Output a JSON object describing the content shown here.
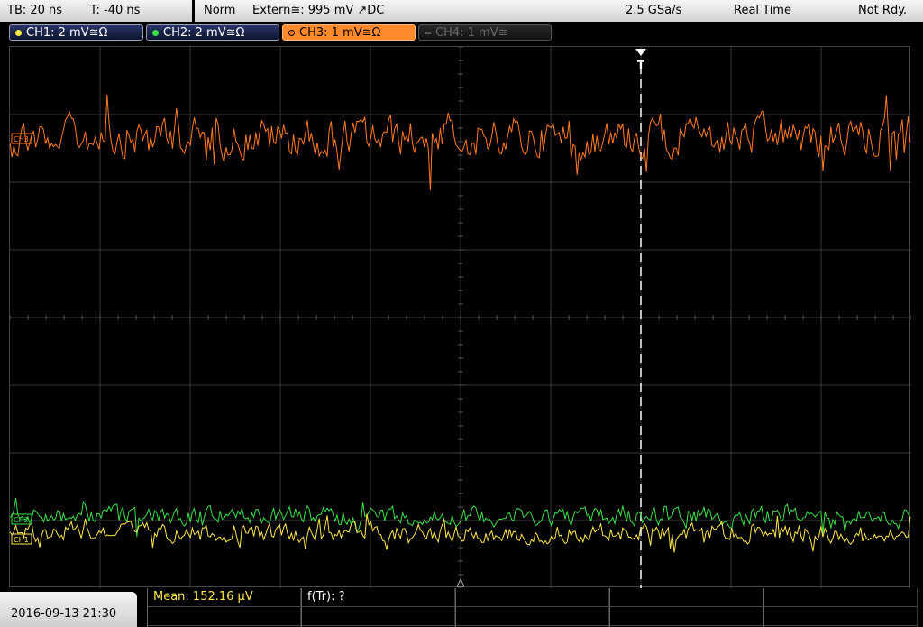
{
  "header": {
    "timebase": "TB: 20 ns",
    "trigger_time": "T: -40 ns",
    "mode": "Norm",
    "trigger_source": "Extern≅: 995 mV ↗DC",
    "sample_rate": "2.5 GSa/s",
    "acquisition": "Real Time",
    "status": "Not Rdy."
  },
  "channels": [
    {
      "label": "CH1: 2 mV≅Ω",
      "color": "#ffe84a",
      "state": "on"
    },
    {
      "label": "CH2: 2 mV≅Ω",
      "color": "#3ae04a",
      "state": "on"
    },
    {
      "label": "CH3: 1 mV≅Ω",
      "color": "#ff7a20",
      "state": "active"
    },
    {
      "label": "CH4: 1 mV≅",
      "color": "#555555",
      "state": "off"
    }
  ],
  "markers": {
    "trigger": "T",
    "ch1": "CH1",
    "ch2": "CH2",
    "ch3": "CH3"
  },
  "footer": {
    "datetime": "2016-09-13 21:30",
    "measurement_1": "Mean: 152.16 µV",
    "measurement_2": "f(Tr): ?"
  }
}
